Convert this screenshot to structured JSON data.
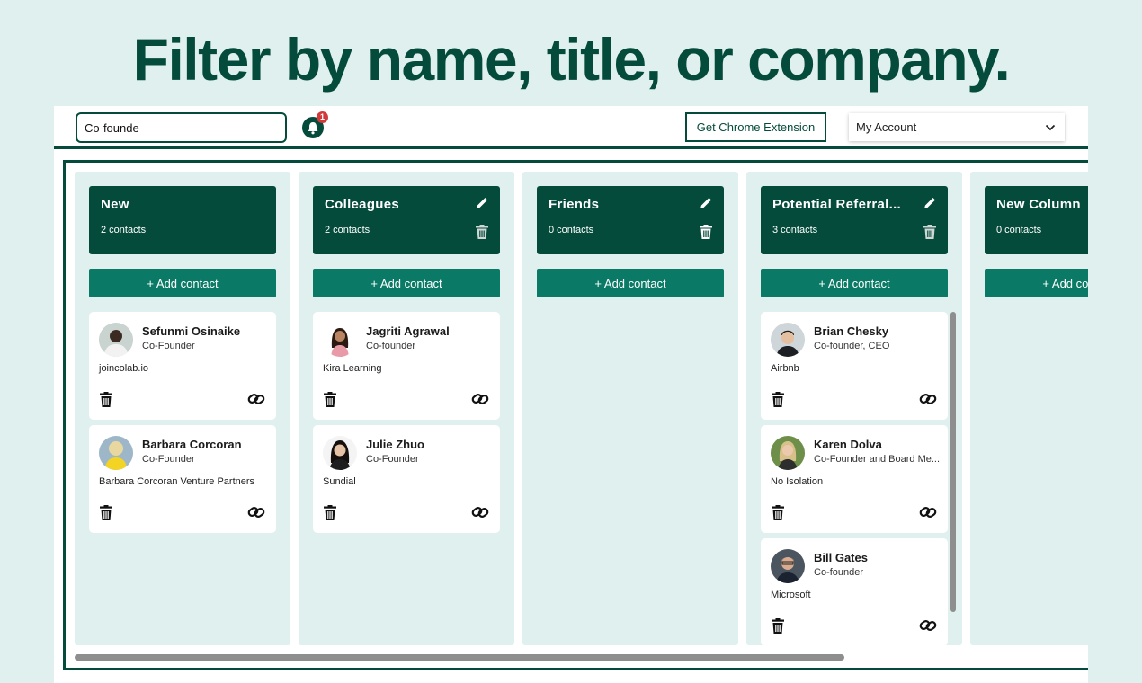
{
  "hero": {
    "title": "Filter by name, title, or company."
  },
  "topbar": {
    "search_value": "Co-founde",
    "notification_count": "1",
    "chrome_button": "Get Chrome Extension",
    "account_label": "My Account"
  },
  "colors": {
    "primary": "#054b3c",
    "accent": "#0a7a66",
    "background": "#dff0ef",
    "badge": "#d23a3a"
  },
  "columns": [
    {
      "title": "New",
      "count": "2 contacts",
      "add_label": "+ Add contact",
      "cards": [
        {
          "name": "Sefunmi Osinaike",
          "title": "Co-Founder",
          "company": "joincolab.io"
        },
        {
          "name": "Barbara Corcoran",
          "title": "Co-Founder",
          "company": "Barbara Corcoran Venture Partners"
        }
      ]
    },
    {
      "title": "Colleagues",
      "count": "2 contacts",
      "add_label": "+ Add contact",
      "cards": [
        {
          "name": "Jagriti Agrawal",
          "title": "Co-founder",
          "company": "Kira Learning"
        },
        {
          "name": "Julie Zhuo",
          "title": "Co-Founder",
          "company": "Sundial"
        }
      ]
    },
    {
      "title": "Friends",
      "count": "0 contacts",
      "add_label": "+ Add contact",
      "cards": []
    },
    {
      "title": "Potential Referral...",
      "count": "3 contacts",
      "add_label": "+ Add contact",
      "cards": [
        {
          "name": "Brian Chesky",
          "title": "Co-founder, CEO",
          "company": "Airbnb"
        },
        {
          "name": "Karen Dolva",
          "title": "Co-Founder and Board Me...",
          "company": "No Isolation"
        },
        {
          "name": "Bill Gates",
          "title": "Co-founder",
          "company": "Microsoft"
        }
      ]
    },
    {
      "title": "New Column",
      "count": "0 contacts",
      "add_label": "+ Add contact",
      "cards": []
    }
  ]
}
